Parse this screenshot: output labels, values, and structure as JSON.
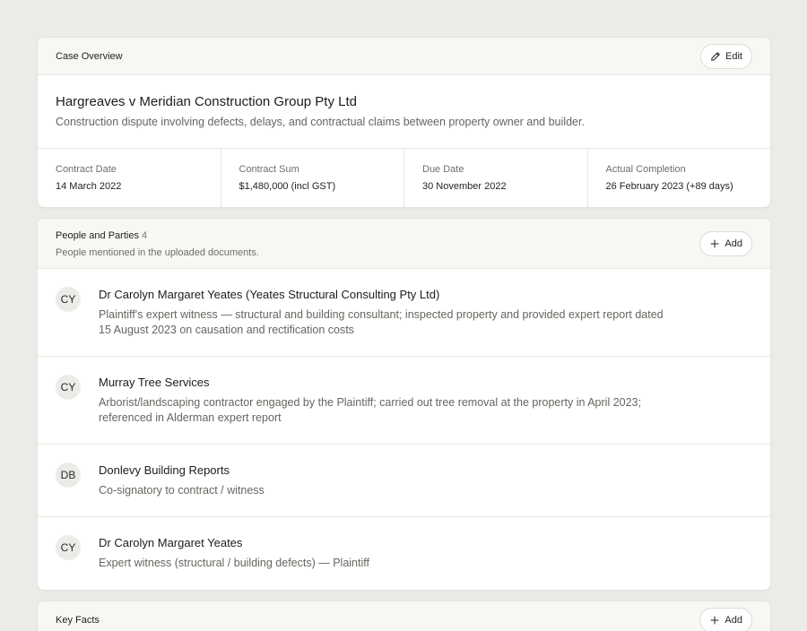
{
  "overview": {
    "header_title": "Case Overview",
    "edit_label": "Edit",
    "case_title": "Hargreaves v Meridian Construction Group Pty Ltd",
    "case_description": "Construction dispute involving defects, delays, and contractual claims between property owner and builder.",
    "stats": [
      {
        "label": "Contract Date",
        "value": "14 March 2022"
      },
      {
        "label": "Contract Sum",
        "value": "$1,480,000 (incl GST)"
      },
      {
        "label": "Due Date",
        "value": "30 November 2022"
      },
      {
        "label": "Actual Completion",
        "value": "26 February 2023 (+89 days)"
      }
    ]
  },
  "people": {
    "header_title": "People and Parties",
    "count": "4",
    "subtitle": "People mentioned in the uploaded documents.",
    "add_label": "Add",
    "items": [
      {
        "initials": "CY",
        "name": "Dr Carolyn Margaret Yeates (Yeates Structural Consulting Pty Ltd)",
        "description": "Plaintiff's expert witness — structural and building consultant; inspected property and provided expert report dated 15 August 2023 on causation and rectification costs"
      },
      {
        "initials": "CY",
        "name": "Murray Tree Services",
        "description": "Arborist/landscaping contractor engaged by the Plaintiff; carried out tree removal at the property in April 2023; referenced in Alderman expert report"
      },
      {
        "initials": "DB",
        "name": "Donlevy Building Reports",
        "description": "Co-signatory to contract / witness"
      },
      {
        "initials": "CY",
        "name": "Dr Carolyn Margaret Yeates",
        "description": "Expert witness (structural / building defects) — Plaintiff"
      }
    ]
  },
  "facts": {
    "header_title": "Key Facts",
    "add_label": "Add"
  },
  "icons": {
    "edit": "pencil-icon",
    "add": "plus-icon"
  },
  "colors": {
    "background": "#ecebe7",
    "card": "#ffffff",
    "header": "#f8f7f4",
    "border": "#e5e3de",
    "muted_text": "#67655f"
  }
}
